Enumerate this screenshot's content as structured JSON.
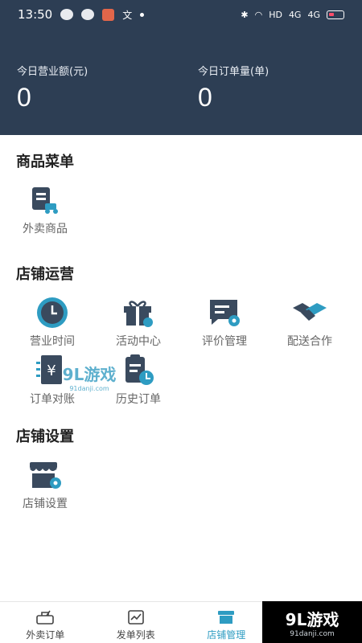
{
  "status_bar": {
    "time": "13:50",
    "network": "HD",
    "signal_1": "4G",
    "signal_2": "4G"
  },
  "stats": {
    "revenue_label": "今日营业额(元)",
    "revenue_value": "0",
    "orders_label": "今日订单量(单)",
    "orders_value": "0"
  },
  "sections": {
    "menu": {
      "title": "商品菜单",
      "items": [
        {
          "label": "外卖商品",
          "icon": "takeout-goods-icon"
        }
      ]
    },
    "operations": {
      "title": "店铺运营",
      "items": [
        {
          "label": "营业时间",
          "icon": "clock-icon"
        },
        {
          "label": "活动中心",
          "icon": "gift-icon"
        },
        {
          "label": "评价管理",
          "icon": "review-icon"
        },
        {
          "label": "配送合作",
          "icon": "handshake-icon"
        },
        {
          "label": "订单对账",
          "icon": "yen-ledger-icon"
        },
        {
          "label": "历史订单",
          "icon": "history-order-icon"
        }
      ]
    },
    "settings": {
      "title": "店铺设置",
      "items": [
        {
          "label": "店铺设置",
          "icon": "store-settings-icon"
        }
      ]
    }
  },
  "bottom_nav": [
    {
      "label": "外卖订单",
      "icon": "takeout-order-icon",
      "active": false
    },
    {
      "label": "发单列表",
      "icon": "dispatch-list-icon",
      "active": false
    },
    {
      "label": "店铺管理",
      "icon": "store-manage-icon",
      "active": true
    }
  ],
  "watermark": {
    "brand": "9L游戏",
    "site": "91danji.com"
  },
  "colors": {
    "header_bg": "#2d3e54",
    "icon_dark": "#3a4a5e",
    "icon_accent": "#2e9cc2"
  }
}
